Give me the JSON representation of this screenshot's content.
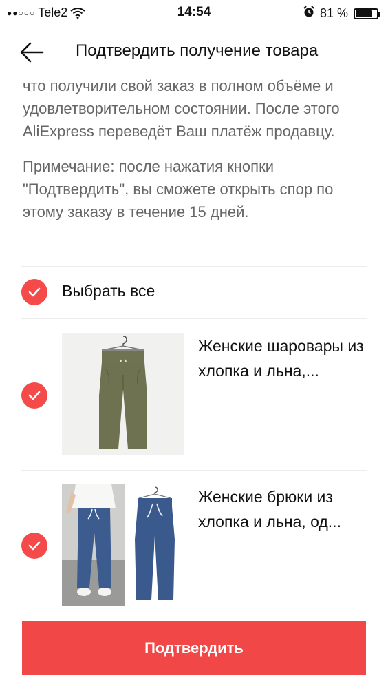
{
  "status_bar": {
    "carrier": "Tele2",
    "time": "14:54",
    "battery_percent": "81 %",
    "battery_level": 0.81
  },
  "header": {
    "title": "Подтвердить получение товара"
  },
  "info": {
    "paragraph1": "что получили свой заказ в полном объёме и удовлетворительном состоянии. После этого AliExpress переведёт Ваш платёж продавцу.",
    "paragraph2": "Примечание: после нажатия кнопки \"Подтвердить\", вы сможете открыть спор по этому заказу в течение 15 дней."
  },
  "select_all": {
    "label": "Выбрать все",
    "checked": true
  },
  "products": [
    {
      "name": "Женские шаровары из хлопка и льна,...",
      "checked": true
    },
    {
      "name": "Женские брюки из хлопка и льна, од...",
      "checked": true
    }
  ],
  "confirm_button": {
    "label": "Подтвердить"
  },
  "colors": {
    "accent": "#f24747",
    "olive_pants": "#6e7250",
    "blue_pants": "#3a5a8e"
  }
}
